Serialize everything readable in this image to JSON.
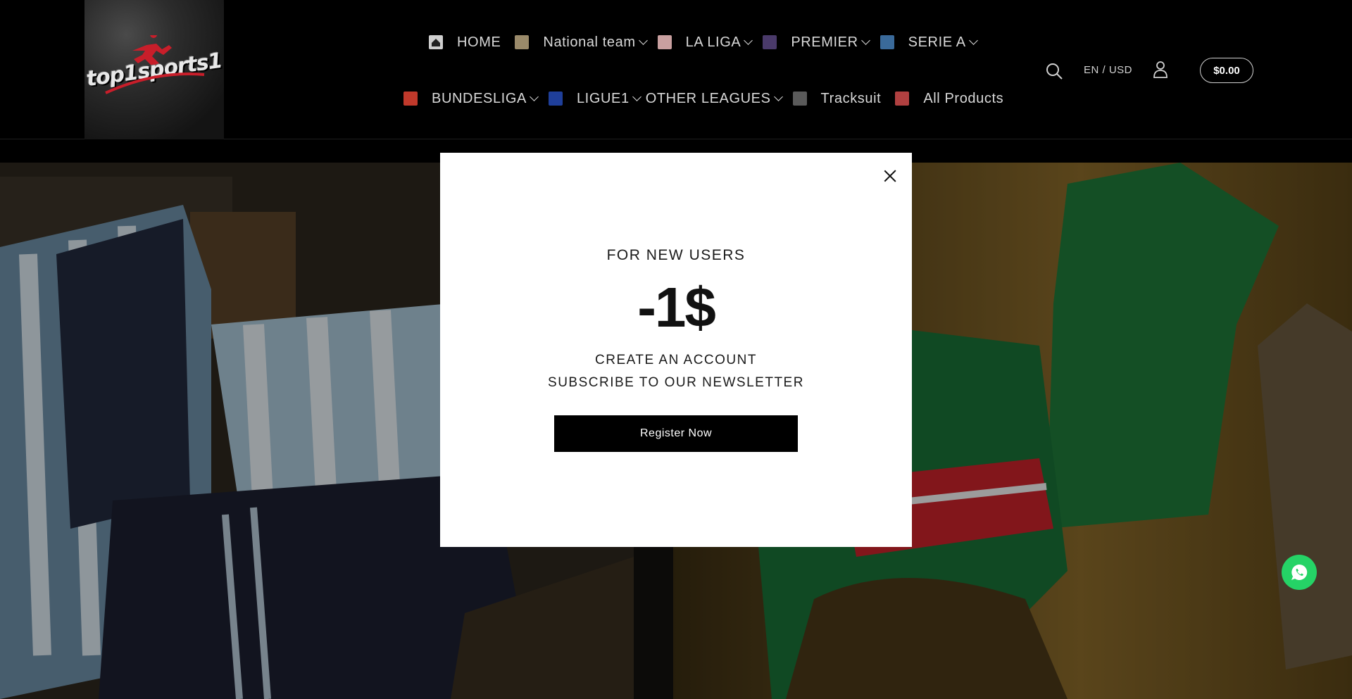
{
  "brand": {
    "logo_text": "top1sports1",
    "logo_accent": "#c81e2a"
  },
  "nav": {
    "row1": [
      {
        "label": "HOME",
        "has_dropdown": false,
        "icon": "home-icon",
        "flag_color": "#cfcfcf"
      },
      {
        "label": "National team",
        "has_dropdown": true,
        "icon": "trophy-icon",
        "flag_color": "#9a8a6a"
      },
      {
        "label": "LA LIGA",
        "has_dropdown": true,
        "icon": "la-liga-icon",
        "flag_color": "#c9a0a0"
      },
      {
        "label": "PREMIER",
        "has_dropdown": true,
        "icon": "premier-league-icon",
        "flag_color": "#4a3a6a"
      },
      {
        "label": "SERIE A",
        "has_dropdown": true,
        "icon": "serie-a-icon",
        "flag_color": "#3a6a9a"
      }
    ],
    "row2": [
      {
        "label": "BUNDESLIGA",
        "has_dropdown": true,
        "icon": "bundesliga-icon",
        "flag_color": "#c0392b"
      },
      {
        "label": "LIGUE1",
        "has_dropdown": true,
        "icon": "ligue1-icon",
        "flag_color": "#1f3f9a"
      },
      {
        "label": "OTHER LEAGUES",
        "has_dropdown": true,
        "icon": "",
        "flag_color": ""
      },
      {
        "label": "Tracksuit",
        "has_dropdown": false,
        "icon": "tracksuit-icon",
        "flag_color": "#5a5a5a"
      },
      {
        "label": "All Products",
        "has_dropdown": false,
        "icon": "all-products-icon",
        "flag_color": "#b04040"
      }
    ]
  },
  "header_utils": {
    "locale": "EN / USD",
    "cart_total": "$0.00",
    "search_icon": "search-icon",
    "account_icon": "account-icon"
  },
  "modal": {
    "eyebrow": "FOR NEW USERS",
    "amount": "-1$",
    "line1": "CREATE AN ACCOUNT",
    "line2": "SUBSCRIBE TO OUR NEWSLETTER",
    "cta": "Register Now"
  },
  "floating": {
    "icon": "whatsapp-icon",
    "color": "#25d366"
  }
}
